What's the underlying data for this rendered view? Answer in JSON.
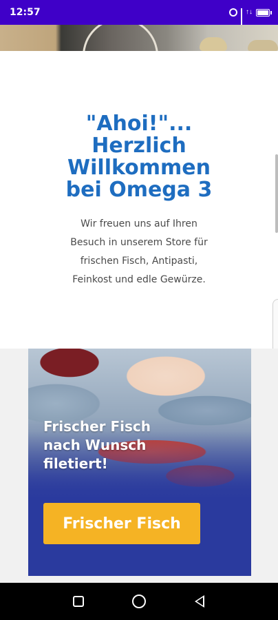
{
  "status_bar": {
    "time": "12:57",
    "icons": [
      "alarm-icon",
      "signal-icon",
      "data-icon",
      "battery-icon"
    ],
    "data_label": "↑↓",
    "color": "#3f00c8"
  },
  "welcome": {
    "title_lines": [
      "\"Ahoi!\"...",
      "Herzlich",
      "Willkommen",
      "bei Omega 3"
    ],
    "text_lines": [
      "Wir freuen uns auf Ihren",
      "Besuch in unserem Store für",
      "frischen Fisch, Antipasti,",
      "Feinkost und edle Gewürze."
    ],
    "title_color": "#1e6dc0"
  },
  "promo": {
    "heading_lines": [
      "Frischer Fisch",
      "nach Wunsch",
      "filetiert!"
    ],
    "button_label": "Frischer Fisch",
    "button_color": "#f5b324",
    "background_color": "#2a3a9e"
  },
  "nav_bar": {
    "buttons": [
      "recents-icon",
      "home-icon",
      "back-icon"
    ]
  }
}
